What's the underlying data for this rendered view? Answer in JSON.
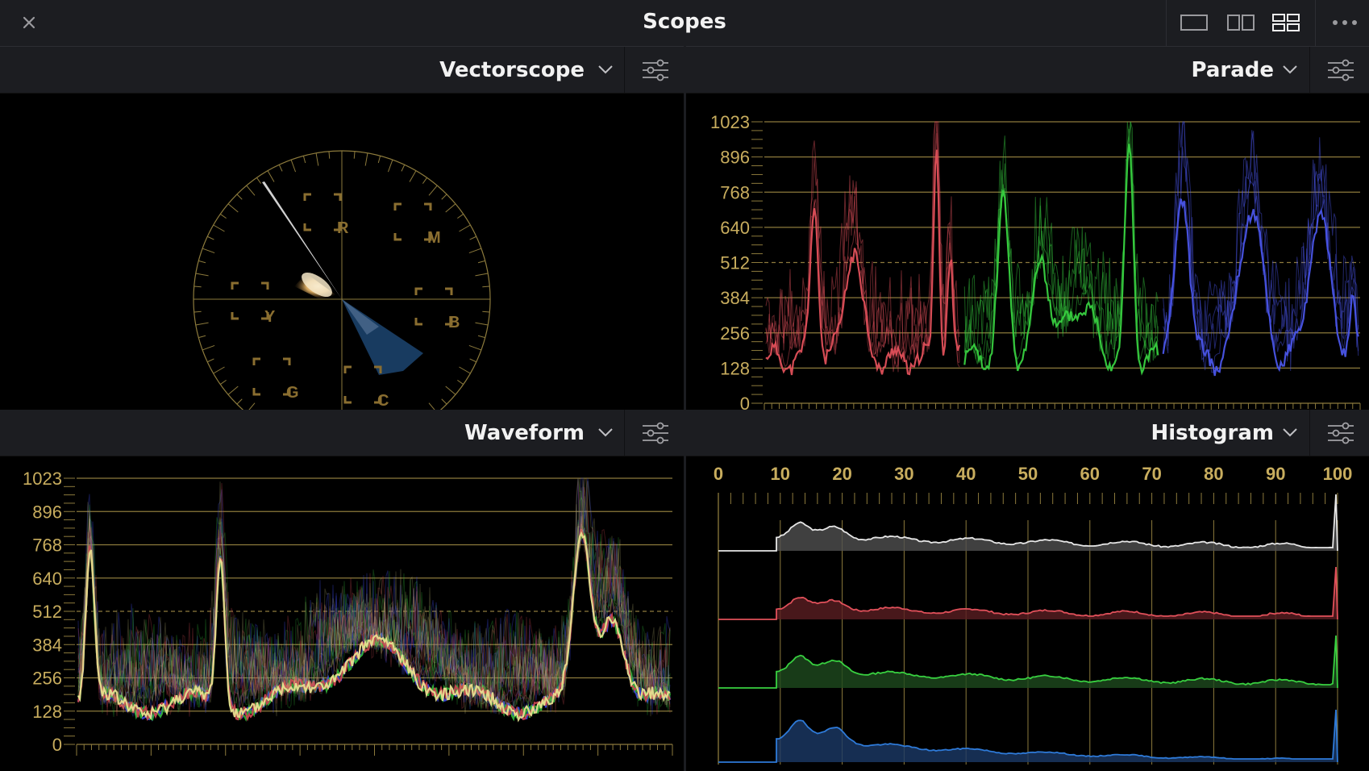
{
  "window": {
    "title": "Scopes"
  },
  "icons": {
    "close": "close-icon",
    "single": "layout-single-icon",
    "dual": "layout-dual-icon",
    "quad": "layout-quad-icon",
    "more": "more-icon",
    "chevron": "chevron-down-icon",
    "options": "sliders-icon"
  },
  "colors": {
    "graticule": "#8c7a3c",
    "label": "#c8ad5e",
    "red": "#e0505a",
    "green": "#38d040",
    "blue": "#4a55e8",
    "panel": "#1c1d21"
  },
  "panels": {
    "vectorscope": {
      "title": "Vectorscope",
      "targets": [
        "R",
        "M",
        "Y",
        "B",
        "G",
        "C"
      ]
    },
    "parade": {
      "title": "Parade",
      "ticks": [
        "1023",
        "896",
        "768",
        "640",
        "512",
        "384",
        "256",
        "128",
        "0"
      ]
    },
    "waveform": {
      "title": "Waveform",
      "ticks": [
        "1023",
        "896",
        "768",
        "640",
        "512",
        "384",
        "256",
        "128",
        "0"
      ]
    },
    "histogram": {
      "title": "Histogram",
      "ticks": [
        "0",
        "10",
        "20",
        "30",
        "40",
        "50",
        "60",
        "70",
        "80",
        "90",
        "100"
      ]
    }
  }
}
